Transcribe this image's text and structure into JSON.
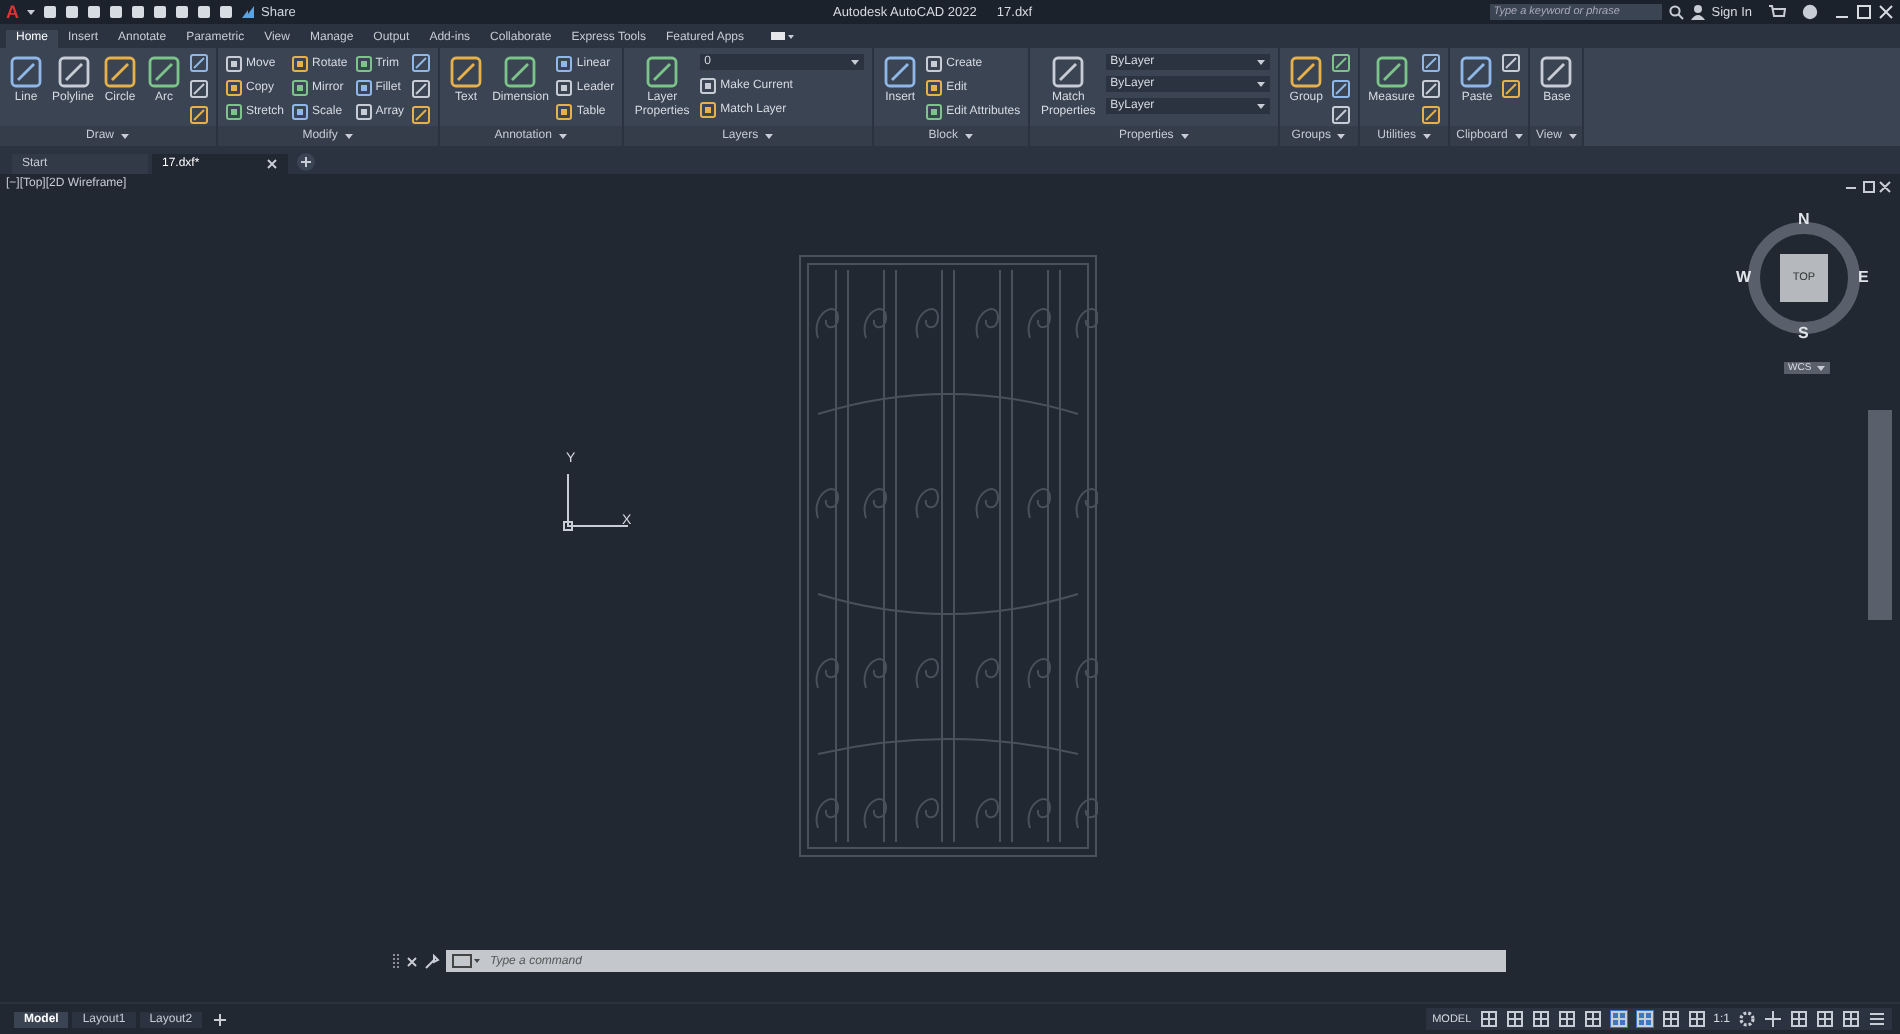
{
  "title_bar": {
    "app_logo": "A",
    "share": "Share",
    "app_title": "Autodesk AutoCAD 2022",
    "file_name": "17.dxf",
    "search": {
      "placeholder": "Type a keyword or phrase"
    },
    "sign_in": "Sign In"
  },
  "ribbon_tabs": [
    {
      "label": "Home",
      "selected": true
    },
    {
      "label": "Insert",
      "selected": false
    },
    {
      "label": "Annotate",
      "selected": false
    },
    {
      "label": "Parametric",
      "selected": false
    },
    {
      "label": "View",
      "selected": false
    },
    {
      "label": "Manage",
      "selected": false
    },
    {
      "label": "Output",
      "selected": false
    },
    {
      "label": "Add-ins",
      "selected": false
    },
    {
      "label": "Collaborate",
      "selected": false
    },
    {
      "label": "Express Tools",
      "selected": false
    },
    {
      "label": "Featured Apps",
      "selected": false
    }
  ],
  "ribbon_panels": [
    {
      "title": "Draw",
      "columns": [
        [
          {
            "kind": "large",
            "label": "Line"
          }
        ],
        [
          {
            "kind": "large",
            "label": "Polyline"
          }
        ],
        [
          {
            "kind": "large",
            "label": "Circle"
          }
        ],
        [
          {
            "kind": "large",
            "label": "Arc"
          }
        ],
        [
          {
            "kind": "icon"
          },
          {
            "kind": "icon"
          },
          {
            "kind": "icon"
          }
        ]
      ]
    },
    {
      "title": "Modify",
      "columns": [
        [
          {
            "kind": "small",
            "label": "Move"
          },
          {
            "kind": "small",
            "label": "Copy"
          },
          {
            "kind": "small",
            "label": "Stretch"
          }
        ],
        [
          {
            "kind": "small",
            "label": "Rotate"
          },
          {
            "kind": "small",
            "label": "Mirror"
          },
          {
            "kind": "small",
            "label": "Scale"
          }
        ],
        [
          {
            "kind": "small",
            "label": "Trim"
          },
          {
            "kind": "small",
            "label": "Fillet"
          },
          {
            "kind": "small",
            "label": "Array"
          }
        ],
        [
          {
            "kind": "icon"
          },
          {
            "kind": "icon"
          },
          {
            "kind": "icon"
          }
        ]
      ]
    },
    {
      "title": "Annotation",
      "columns": [
        [
          {
            "kind": "large",
            "label": "Text"
          }
        ],
        [
          {
            "kind": "large",
            "label": "Dimension"
          }
        ],
        [
          {
            "kind": "small",
            "label": "Linear"
          },
          {
            "kind": "small",
            "label": "Leader"
          },
          {
            "kind": "small",
            "label": "Table"
          }
        ]
      ]
    },
    {
      "title": "Layers",
      "columns": [
        [
          {
            "kind": "large",
            "label": "Layer Properties"
          }
        ],
        [
          {
            "kind": "combo",
            "value": "0"
          },
          {
            "kind": "small",
            "label": "Make Current"
          },
          {
            "kind": "small",
            "label": "Match Layer"
          }
        ]
      ]
    },
    {
      "title": "Block",
      "columns": [
        [
          {
            "kind": "large",
            "label": "Insert"
          }
        ],
        [
          {
            "kind": "small",
            "label": "Create"
          },
          {
            "kind": "small",
            "label": "Edit"
          },
          {
            "kind": "small",
            "label": "Edit Attributes"
          }
        ]
      ]
    },
    {
      "title": "Properties",
      "columns": [
        [
          {
            "kind": "large",
            "label": "Match Properties"
          }
        ],
        [
          {
            "kind": "combo",
            "value": "ByLayer"
          },
          {
            "kind": "combo",
            "value": "ByLayer"
          },
          {
            "kind": "combo",
            "value": "ByLayer"
          }
        ]
      ]
    },
    {
      "title": "Groups",
      "columns": [
        [
          {
            "kind": "large",
            "label": "Group"
          }
        ],
        [
          {
            "kind": "icon"
          },
          {
            "kind": "icon"
          },
          {
            "kind": "icon"
          }
        ]
      ]
    },
    {
      "title": "Utilities",
      "columns": [
        [
          {
            "kind": "large",
            "label": "Measure"
          }
        ],
        [
          {
            "kind": "icon"
          },
          {
            "kind": "icon"
          },
          {
            "kind": "icon"
          }
        ]
      ]
    },
    {
      "title": "Clipboard",
      "columns": [
        [
          {
            "kind": "large",
            "label": "Paste"
          }
        ],
        [
          {
            "kind": "icon"
          },
          {
            "kind": "icon"
          }
        ]
      ]
    },
    {
      "title": "View",
      "columns": [
        [
          {
            "kind": "large",
            "label": "Base"
          }
        ]
      ]
    }
  ],
  "doc_tabs": [
    {
      "label": "Start",
      "selected": false
    },
    {
      "label": "17.dxf*",
      "selected": true
    }
  ],
  "viewport": {
    "label": "[−][Top][2D Wireframe]",
    "ucs": {
      "x": "X",
      "y": "Y"
    },
    "viewcube": {
      "face": "TOP",
      "north": "N",
      "south": "S",
      "east": "E",
      "west": "W",
      "wcs": "WCS"
    }
  },
  "command_line": {
    "placeholder": "Type a command"
  },
  "layout_tabs": [
    {
      "label": "Model",
      "selected": true
    },
    {
      "label": "Layout1",
      "selected": false
    },
    {
      "label": "Layout2",
      "selected": false
    }
  ],
  "status_bar": {
    "model": "MODEL",
    "scale": "1:1"
  }
}
